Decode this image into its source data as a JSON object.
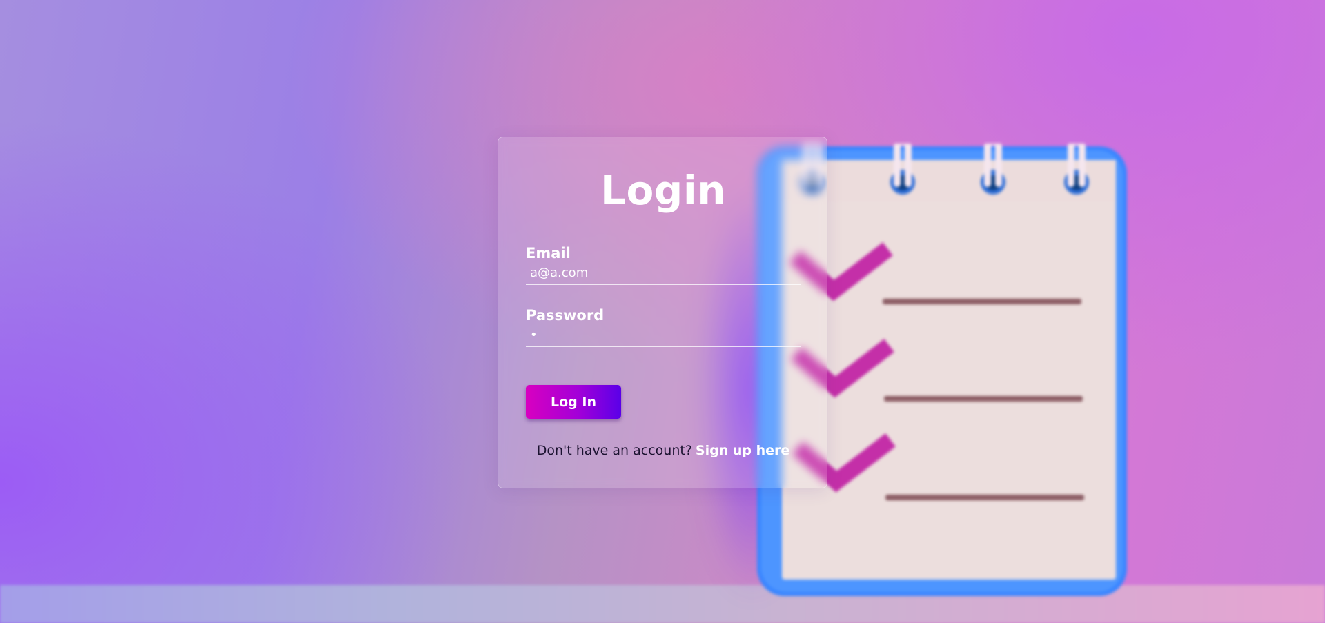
{
  "login": {
    "title": "Login",
    "email": {
      "label": "Email",
      "value": "a@a.com"
    },
    "password": {
      "label": "Password",
      "value": "•"
    },
    "submit_label": "Log In",
    "signup": {
      "prompt": "Don't have an account?",
      "link_label": "Sign up here"
    }
  },
  "colors": {
    "button_gradient_start": "#d800c0",
    "button_gradient_end": "#5a00e8",
    "notepad_frame": "#3d8bff",
    "notepad_paper": "#ecdcdc",
    "checkmark": "#c42fa8",
    "line": "#8a5a62"
  },
  "illustration": {
    "name": "checklist-notepad",
    "checklist_items": 3,
    "spiral_rings": 4
  }
}
